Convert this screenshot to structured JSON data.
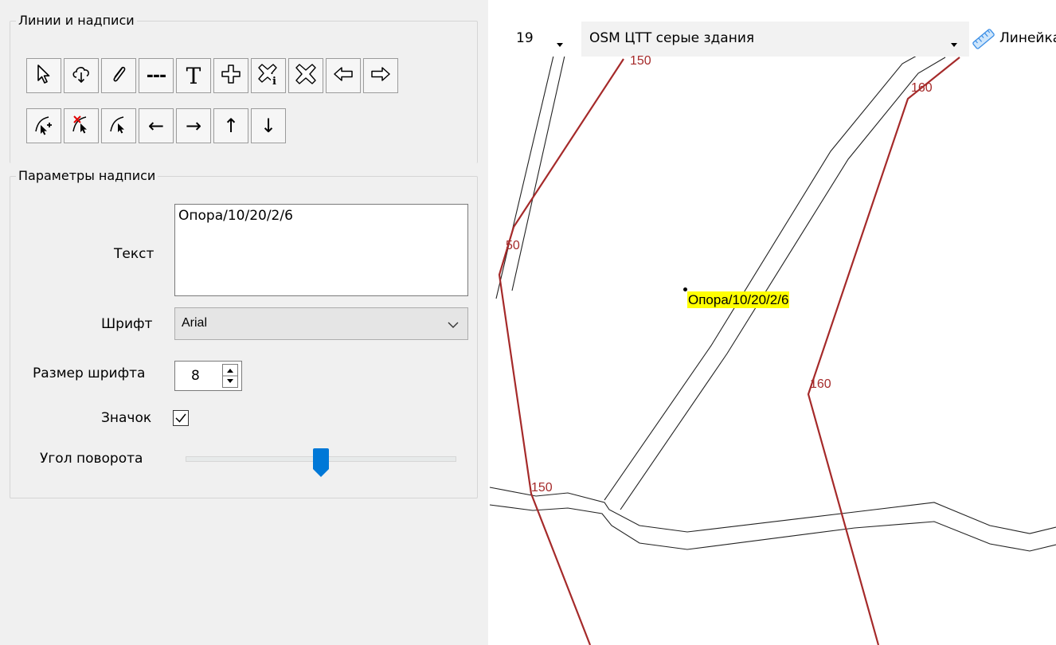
{
  "lines_group": {
    "title": "Линии и надписи",
    "tools_row1": [
      {
        "name": "select-arrow-icon",
        "label": ""
      },
      {
        "name": "cloud-download-icon",
        "label": ""
      },
      {
        "name": "paperclip-icon",
        "label": ""
      },
      {
        "name": "dashed-line-icon",
        "label": "---"
      },
      {
        "name": "text-tool-icon",
        "label": "T"
      },
      {
        "name": "add-cross-icon",
        "label": ""
      },
      {
        "name": "delete-info-icon",
        "label": ""
      },
      {
        "name": "delete-cross-icon",
        "label": ""
      },
      {
        "name": "arrow-left-outline-icon",
        "label": ""
      },
      {
        "name": "arrow-right-outline-icon",
        "label": ""
      }
    ],
    "tools_row2": [
      {
        "name": "add-vertex-icon",
        "label": ""
      },
      {
        "name": "delete-vertex-icon",
        "label": ""
      },
      {
        "name": "move-vertex-icon",
        "label": ""
      },
      {
        "name": "arrow-left-icon",
        "label": "←"
      },
      {
        "name": "arrow-right-icon",
        "label": "→"
      },
      {
        "name": "arrow-up-icon",
        "label": "↑"
      },
      {
        "name": "arrow-down-icon",
        "label": "↓"
      }
    ]
  },
  "params_group": {
    "title": "Параметры надписи",
    "text_label": "Текст",
    "text_value": "Опора/10/20/2/6",
    "font_label": "Шрифт",
    "font_value": "Arial",
    "size_label": "Размер шрифта",
    "size_value": "8",
    "icon_label": "Значок",
    "icon_checked": true,
    "angle_label": "Угол поворота",
    "angle_fraction": 0.5
  },
  "map": {
    "zoom_value": "19",
    "layer_value": "OSM ЦТТ серые здания",
    "ruler_label": "Линейка",
    "label_text": "Опора/10/20/2/6",
    "contour_labels": [
      "150",
      "160",
      "50",
      "160",
      "150"
    ],
    "contour_color": "#a52a2a"
  }
}
